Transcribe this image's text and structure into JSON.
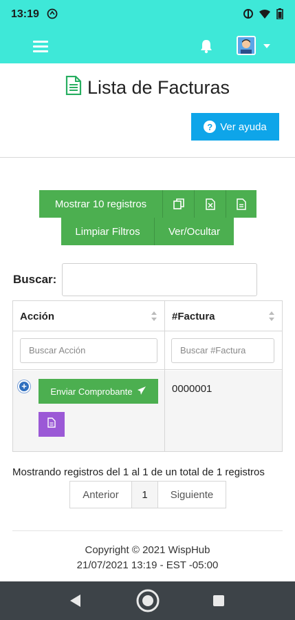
{
  "status_bar": {
    "time": "13:19"
  },
  "header": {
    "menu_icon": "hamburger-icon",
    "notification_icon": "bell-icon",
    "avatar_icon": "user-avatar",
    "dropdown_icon": "caret-down-icon",
    "accent_color": "#3ee8d8"
  },
  "page": {
    "title": "Lista de Facturas",
    "title_icon": "document-icon",
    "help_button": "Ver ayuda"
  },
  "toolbar": {
    "show_records": "Mostrar 10 registros",
    "copy_icon": "copy-icon",
    "excel_icon": "excel-icon",
    "pdf_icon": "pdf-icon",
    "clear_filters": "Limpiar Filtros",
    "show_hide": "Ver/Ocultar",
    "button_color": "#4caf50"
  },
  "search": {
    "label": "Buscar:",
    "value": ""
  },
  "table": {
    "columns": [
      "Acción",
      "#Factura"
    ],
    "filters": [
      "Buscar Acción",
      "Buscar #Factura"
    ],
    "rows": [
      {
        "action_button": "Enviar Comprobante",
        "invoice": "0000001"
      }
    ]
  },
  "pagination": {
    "info": "Mostrando registros del 1 al 1 de un total de 1 registros",
    "previous": "Anterior",
    "current": "1",
    "next": "Siguiente"
  },
  "footer": {
    "copyright": "Copyright © 2021 WispHub",
    "datetime": "21/07/2021 13:19 - EST -05:00"
  }
}
